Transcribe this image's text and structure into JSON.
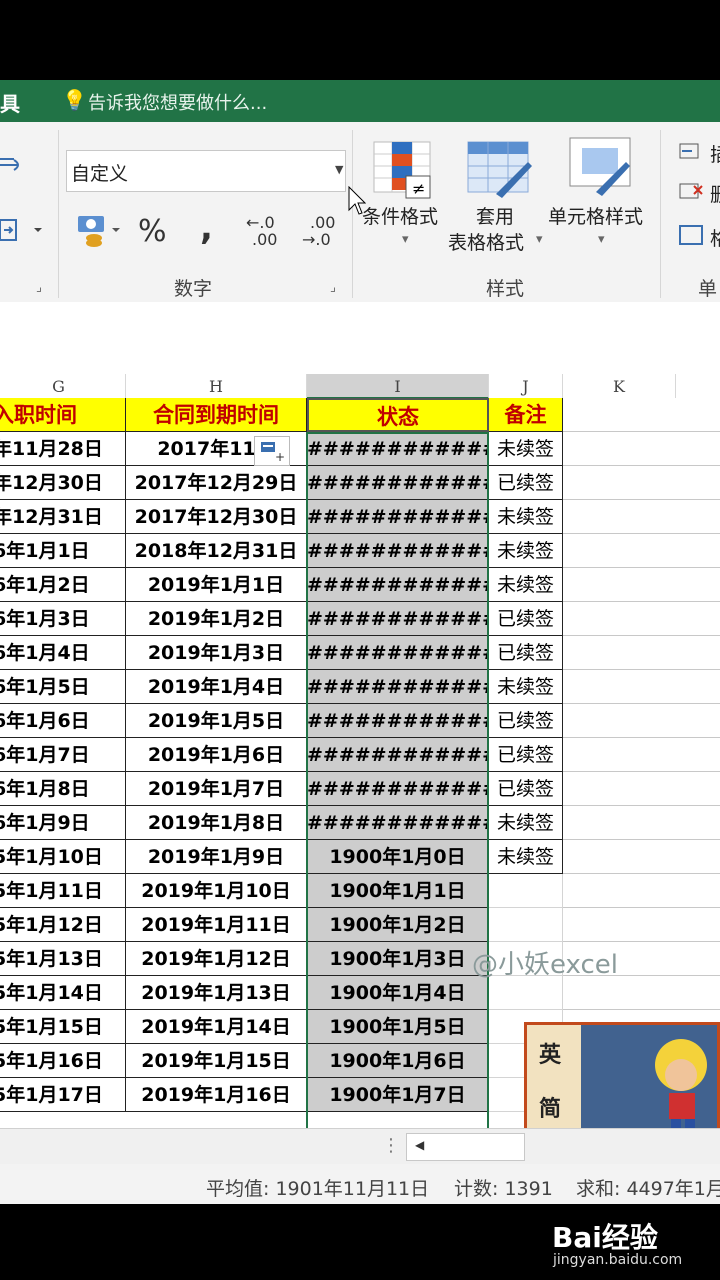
{
  "titlebar": {
    "tools_label": "具",
    "tell_me": "告诉我您想要做什么..."
  },
  "ribbon": {
    "number_format": "自定义",
    "percent": "%",
    "comma": ",",
    "inc_dec_a": "←.0",
    "inc_dec_a2": ".00",
    "inc_dec_b": ".00",
    "inc_dec_b2": "→.0",
    "group_number": "数字",
    "cond_format": "条件格式",
    "table_format_1": "套用",
    "table_format_2": "表格格式",
    "cell_styles": "单元格样式",
    "group_styles": "样式",
    "group_cells": "单",
    "right_cut_1": "插",
    "right_cut_2": "删",
    "right_cut_3": "格"
  },
  "columns": [
    "G",
    "H",
    "I",
    "J",
    "K"
  ],
  "header": {
    "g": "入职时间",
    "h": "合同到期时间",
    "i": "状态",
    "j": "备注"
  },
  "rows": [
    {
      "g": "年11月28日",
      "h": "2017年11月",
      "i": "#############",
      "j": "未续签"
    },
    {
      "g": "年12月30日",
      "h": "2017年12月29日",
      "i": "#############",
      "j": "已续签"
    },
    {
      "g": "年12月31日",
      "h": "2017年12月30日",
      "i": "#############",
      "j": "未续签"
    },
    {
      "g": "6年1月1日",
      "h": "2018年12月31日",
      "i": "#############",
      "j": "未续签"
    },
    {
      "g": "6年1月2日",
      "h": "2019年1月1日",
      "i": "#############",
      "j": "未续签"
    },
    {
      "g": "6年1月3日",
      "h": "2019年1月2日",
      "i": "#############",
      "j": "已续签"
    },
    {
      "g": "6年1月4日",
      "h": "2019年1月3日",
      "i": "#############",
      "j": "已续签"
    },
    {
      "g": "6年1月5日",
      "h": "2019年1月4日",
      "i": "#############",
      "j": "未续签"
    },
    {
      "g": "6年1月6日",
      "h": "2019年1月5日",
      "i": "#############",
      "j": "已续签"
    },
    {
      "g": "6年1月7日",
      "h": "2019年1月6日",
      "i": "#############",
      "j": "已续签"
    },
    {
      "g": "6年1月8日",
      "h": "2019年1月7日",
      "i": "#############",
      "j": "已续签"
    },
    {
      "g": "6年1月9日",
      "h": "2019年1月8日",
      "i": "#############",
      "j": "未续签"
    },
    {
      "g": "5年1月10日",
      "h": "2019年1月9日",
      "i": "1900年1月0日",
      "j": "未续签"
    },
    {
      "g": "5年1月11日",
      "h": "2019年1月10日",
      "i": "1900年1月1日",
      "j": ""
    },
    {
      "g": "5年1月12日",
      "h": "2019年1月11日",
      "i": "1900年1月2日",
      "j": ""
    },
    {
      "g": "5年1月13日",
      "h": "2019年1月12日",
      "i": "1900年1月3日",
      "j": ""
    },
    {
      "g": "5年1月14日",
      "h": "2019年1月13日",
      "i": "1900年1月4日",
      "j": ""
    },
    {
      "g": "5年1月15日",
      "h": "2019年1月14日",
      "i": "1900年1月5日",
      "j": ""
    },
    {
      "g": "5年1月16日",
      "h": "2019年1月15日",
      "i": "1900年1月6日",
      "j": ""
    },
    {
      "g": "5年1月17日",
      "h": "2019年1月16日",
      "i": "1900年1月7日",
      "j": ""
    }
  ],
  "statusbar": {
    "average": "平均值: 1901年11月11日",
    "count": "计数: 1391",
    "sum": "求和: 4497年1月"
  },
  "watermark": "@小妖excel",
  "thumbnail": {
    "text1": "英",
    "text2": "简"
  },
  "baidu": {
    "logo": "Bai经验",
    "url": "jingyan.baidu.com"
  }
}
